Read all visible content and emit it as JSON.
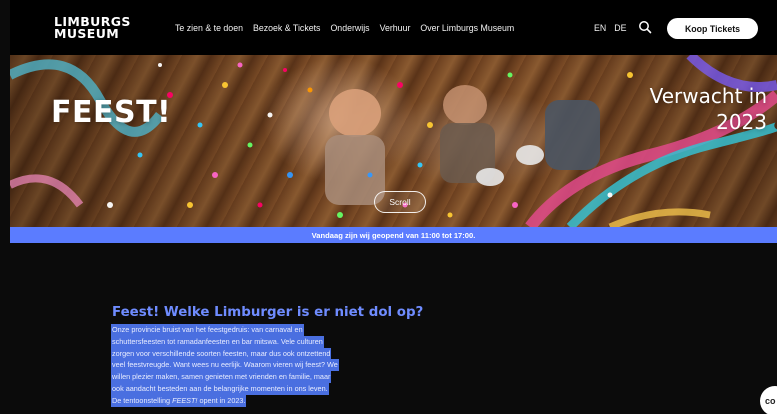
{
  "brand": {
    "logo_line1": "LIMBURGS",
    "logo_line2": "MUSEUM"
  },
  "nav": {
    "items": [
      {
        "label": "Te zien & te doen"
      },
      {
        "label": "Bezoek & Tickets"
      },
      {
        "label": "Onderwijs"
      },
      {
        "label": "Verhuur"
      },
      {
        "label": "Over Limburgs Museum"
      }
    ],
    "languages": [
      "EN",
      "DE"
    ],
    "search_icon": "search-icon",
    "cta_label": "Koop Tickets"
  },
  "hero": {
    "title": "FEEST!",
    "date_line1": "Verwacht in",
    "date_line2": "2023",
    "scroll_label": "Scroll"
  },
  "infobar": {
    "text": "Vandaag zijn wij geopend van 11:00 tot 17:00."
  },
  "intro": {
    "title": "Feest! Welke Limburger is er niet dol op?",
    "lines": [
      "Onze provincie bruist van het feestgedruis: van carnaval en",
      "schuttersfeesten tot ramadanfeesten en bar mitswa. Vele culturen",
      "zorgen voor verschillende soorten feesten, maar dus ook ontzettend",
      "veel feestvreugde. Want wees nu eerlijk. Waarom vieren wij feest? We",
      "willen plezier maken, samen genieten met vrienden en familie, maar",
      "ook aandacht besteden aan de belangrijke momenten in ons leven."
    ],
    "last_line_prefix": "De tentoonstelling ",
    "last_line_em": "FEEST!",
    "last_line_suffix": " opent in 2023."
  },
  "cookie": {
    "label": "co"
  },
  "colors": {
    "accent": "#5b7cff",
    "title_blue": "#6f8cff",
    "selection": "#4a6fe0",
    "background": "#0b0b0b"
  }
}
